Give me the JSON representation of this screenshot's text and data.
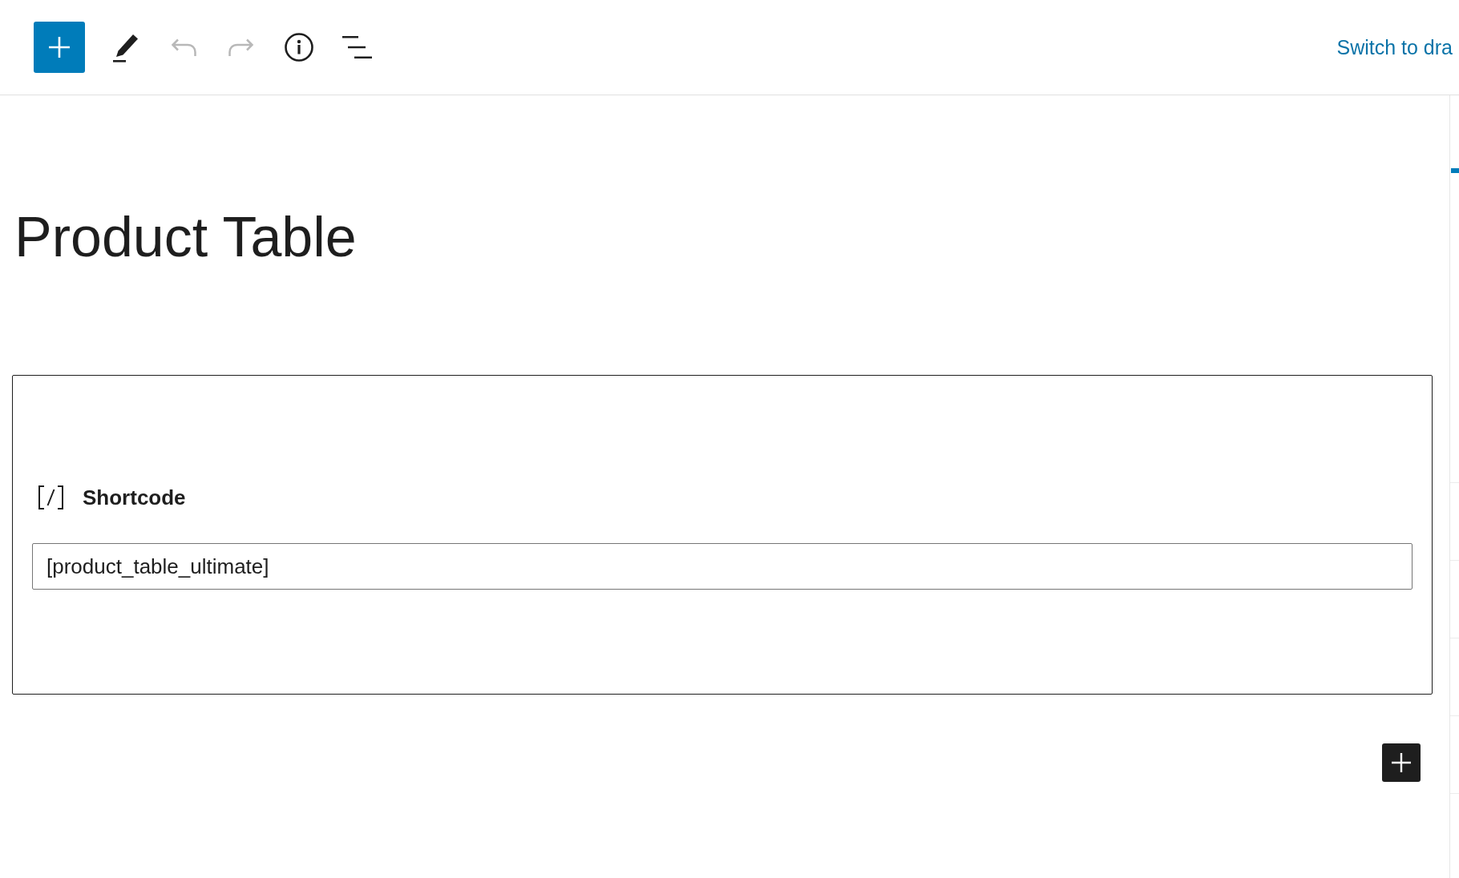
{
  "toolbar": {
    "tools": [
      {
        "kind": "add",
        "disabled": false
      },
      {
        "kind": "edit",
        "disabled": false
      },
      {
        "kind": "undo",
        "disabled": true
      },
      {
        "kind": "redo",
        "disabled": true
      },
      {
        "kind": "info",
        "disabled": false
      },
      {
        "kind": "outline",
        "disabled": false
      }
    ],
    "switch_link": "Switch to dra"
  },
  "post": {
    "title": "Product Table"
  },
  "blocks": [
    {
      "kind": "shortcode",
      "label": "Shortcode",
      "value": "[product_table_ultimate]"
    }
  ]
}
